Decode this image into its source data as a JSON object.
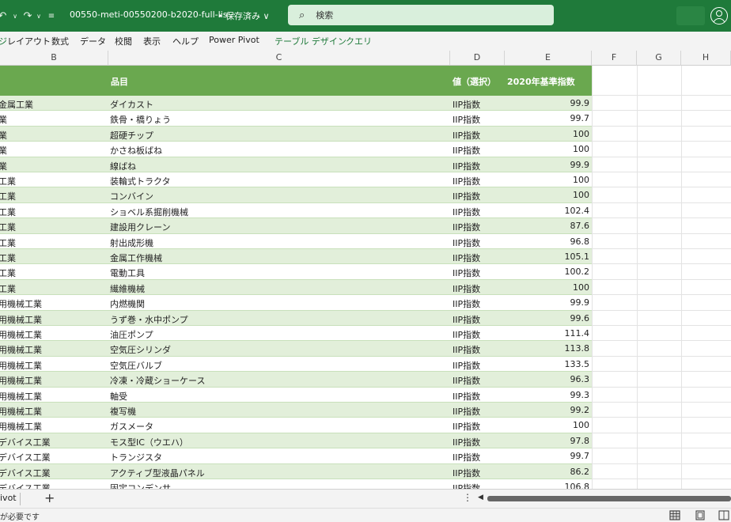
{
  "titlebar": {
    "doc_title": "00550-meti-00550200-b2020-full-lis···",
    "saved": "• 保存済み ∨",
    "search_placeholder": "検索",
    "search_icon": "⌕",
    "undo_icon": "↶",
    "redo_icon": "↷",
    "customize_icon": "⋮"
  },
  "menu": {
    "items": [
      "レイアウト",
      "数式",
      "データ",
      "校閲",
      "表示",
      "ヘルプ",
      "Power Pivot"
    ],
    "context_items": [
      "テーブル デザイン",
      "クエリ"
    ]
  },
  "columns": [
    "B",
    "C",
    "D",
    "E",
    "F",
    "G",
    "H"
  ],
  "table": {
    "headers": {
      "c": "品目",
      "d": "値（選択）",
      "e": "2020年基準指数"
    },
    "rows": [
      [
        "金属工業",
        "ダイカスト",
        "IIP指数",
        "99.9"
      ],
      [
        "業",
        "鉄骨・橋りょう",
        "IIP指数",
        "99.7"
      ],
      [
        "業",
        "超硬チップ",
        "IIP指数",
        "100"
      ],
      [
        "業",
        "かさね板ばね",
        "IIP指数",
        "100"
      ],
      [
        "業",
        "線ばね",
        "IIP指数",
        "99.9"
      ],
      [
        "工業",
        "装輪式トラクタ",
        "IIP指数",
        "100"
      ],
      [
        "工業",
        "コンバイン",
        "IIP指数",
        "100"
      ],
      [
        "工業",
        "ショベル系掘削機械",
        "IIP指数",
        "102.4"
      ],
      [
        "工業",
        "建設用クレーン",
        "IIP指数",
        "87.6"
      ],
      [
        "工業",
        "射出成形機",
        "IIP指数",
        "96.8"
      ],
      [
        "工業",
        "金属工作機械",
        "IIP指数",
        "105.1"
      ],
      [
        "工業",
        "電動工具",
        "IIP指数",
        "100.2"
      ],
      [
        "工業",
        "繊維機械",
        "IIP指数",
        "100"
      ],
      [
        "用機械工業",
        "内燃機関",
        "IIP指数",
        "99.9"
      ],
      [
        "用機械工業",
        "うず巻・水中ポンプ",
        "IIP指数",
        "99.6"
      ],
      [
        "用機械工業",
        "油圧ポンプ",
        "IIP指数",
        "111.4"
      ],
      [
        "用機械工業",
        "空気圧シリンダ",
        "IIP指数",
        "113.8"
      ],
      [
        "用機械工業",
        "空気圧バルブ",
        "IIP指数",
        "133.5"
      ],
      [
        "用機械工業",
        "冷凍・冷蔵ショーケース",
        "IIP指数",
        "96.3"
      ],
      [
        "用機械工業",
        "軸受",
        "IIP指数",
        "99.3"
      ],
      [
        "用機械工業",
        "複写機",
        "IIP指数",
        "99.2"
      ],
      [
        "用機械工業",
        "ガスメータ",
        "IIP指数",
        "100"
      ],
      [
        "デバイス工業",
        "モス型IC（ウエハ）",
        "IIP指数",
        "97.8"
      ],
      [
        "デバイス工業",
        "トランジスタ",
        "IIP指数",
        "99.7"
      ],
      [
        "デバイス工業",
        "アクティブ型液晶パネル",
        "IIP指数",
        "86.2"
      ],
      [
        "デバイス工業",
        "固定コンデンサ",
        "IIP指数",
        "106.8"
      ]
    ]
  },
  "sheet_tabs": {
    "current": "ivot",
    "add_icon": "+",
    "more_icon": "⋮",
    "scroll_icon": "◀"
  },
  "status": {
    "text": "が必要です"
  },
  "colors": {
    "titlebar": "#1f7a3a",
    "table_header": "#6aa84f",
    "band": "#e2efda"
  }
}
